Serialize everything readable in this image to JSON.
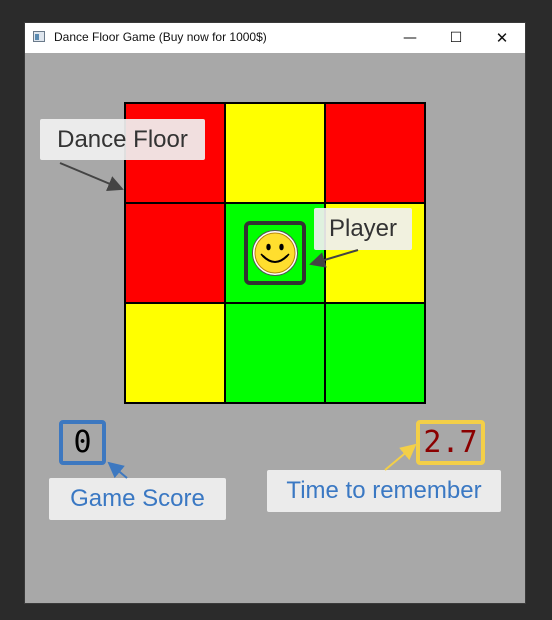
{
  "window": {
    "title": "Dance Floor Game (Buy now for 1000$)",
    "controls": {
      "minimize": "—",
      "maximize": "☐",
      "close": "✕"
    }
  },
  "board": {
    "rows": 3,
    "cols": 3,
    "tiles": [
      [
        "red",
        "yellow",
        "red"
      ],
      [
        "red",
        "green",
        "yellow"
      ],
      [
        "yellow",
        "green",
        "green"
      ]
    ],
    "player_position": {
      "row": 1,
      "col": 1
    },
    "colors": {
      "red": "#ff0000",
      "yellow": "#ffff00",
      "green": "#00ff00"
    }
  },
  "hud": {
    "score": "0",
    "timer": "2.7"
  },
  "annotations": {
    "dance_floor": "Dance Floor",
    "player": "Player",
    "game_score": "Game Score",
    "time_to_remember": "Time to remember"
  },
  "icons": {
    "player": "smiley-face-icon",
    "app": "app-window-icon"
  }
}
